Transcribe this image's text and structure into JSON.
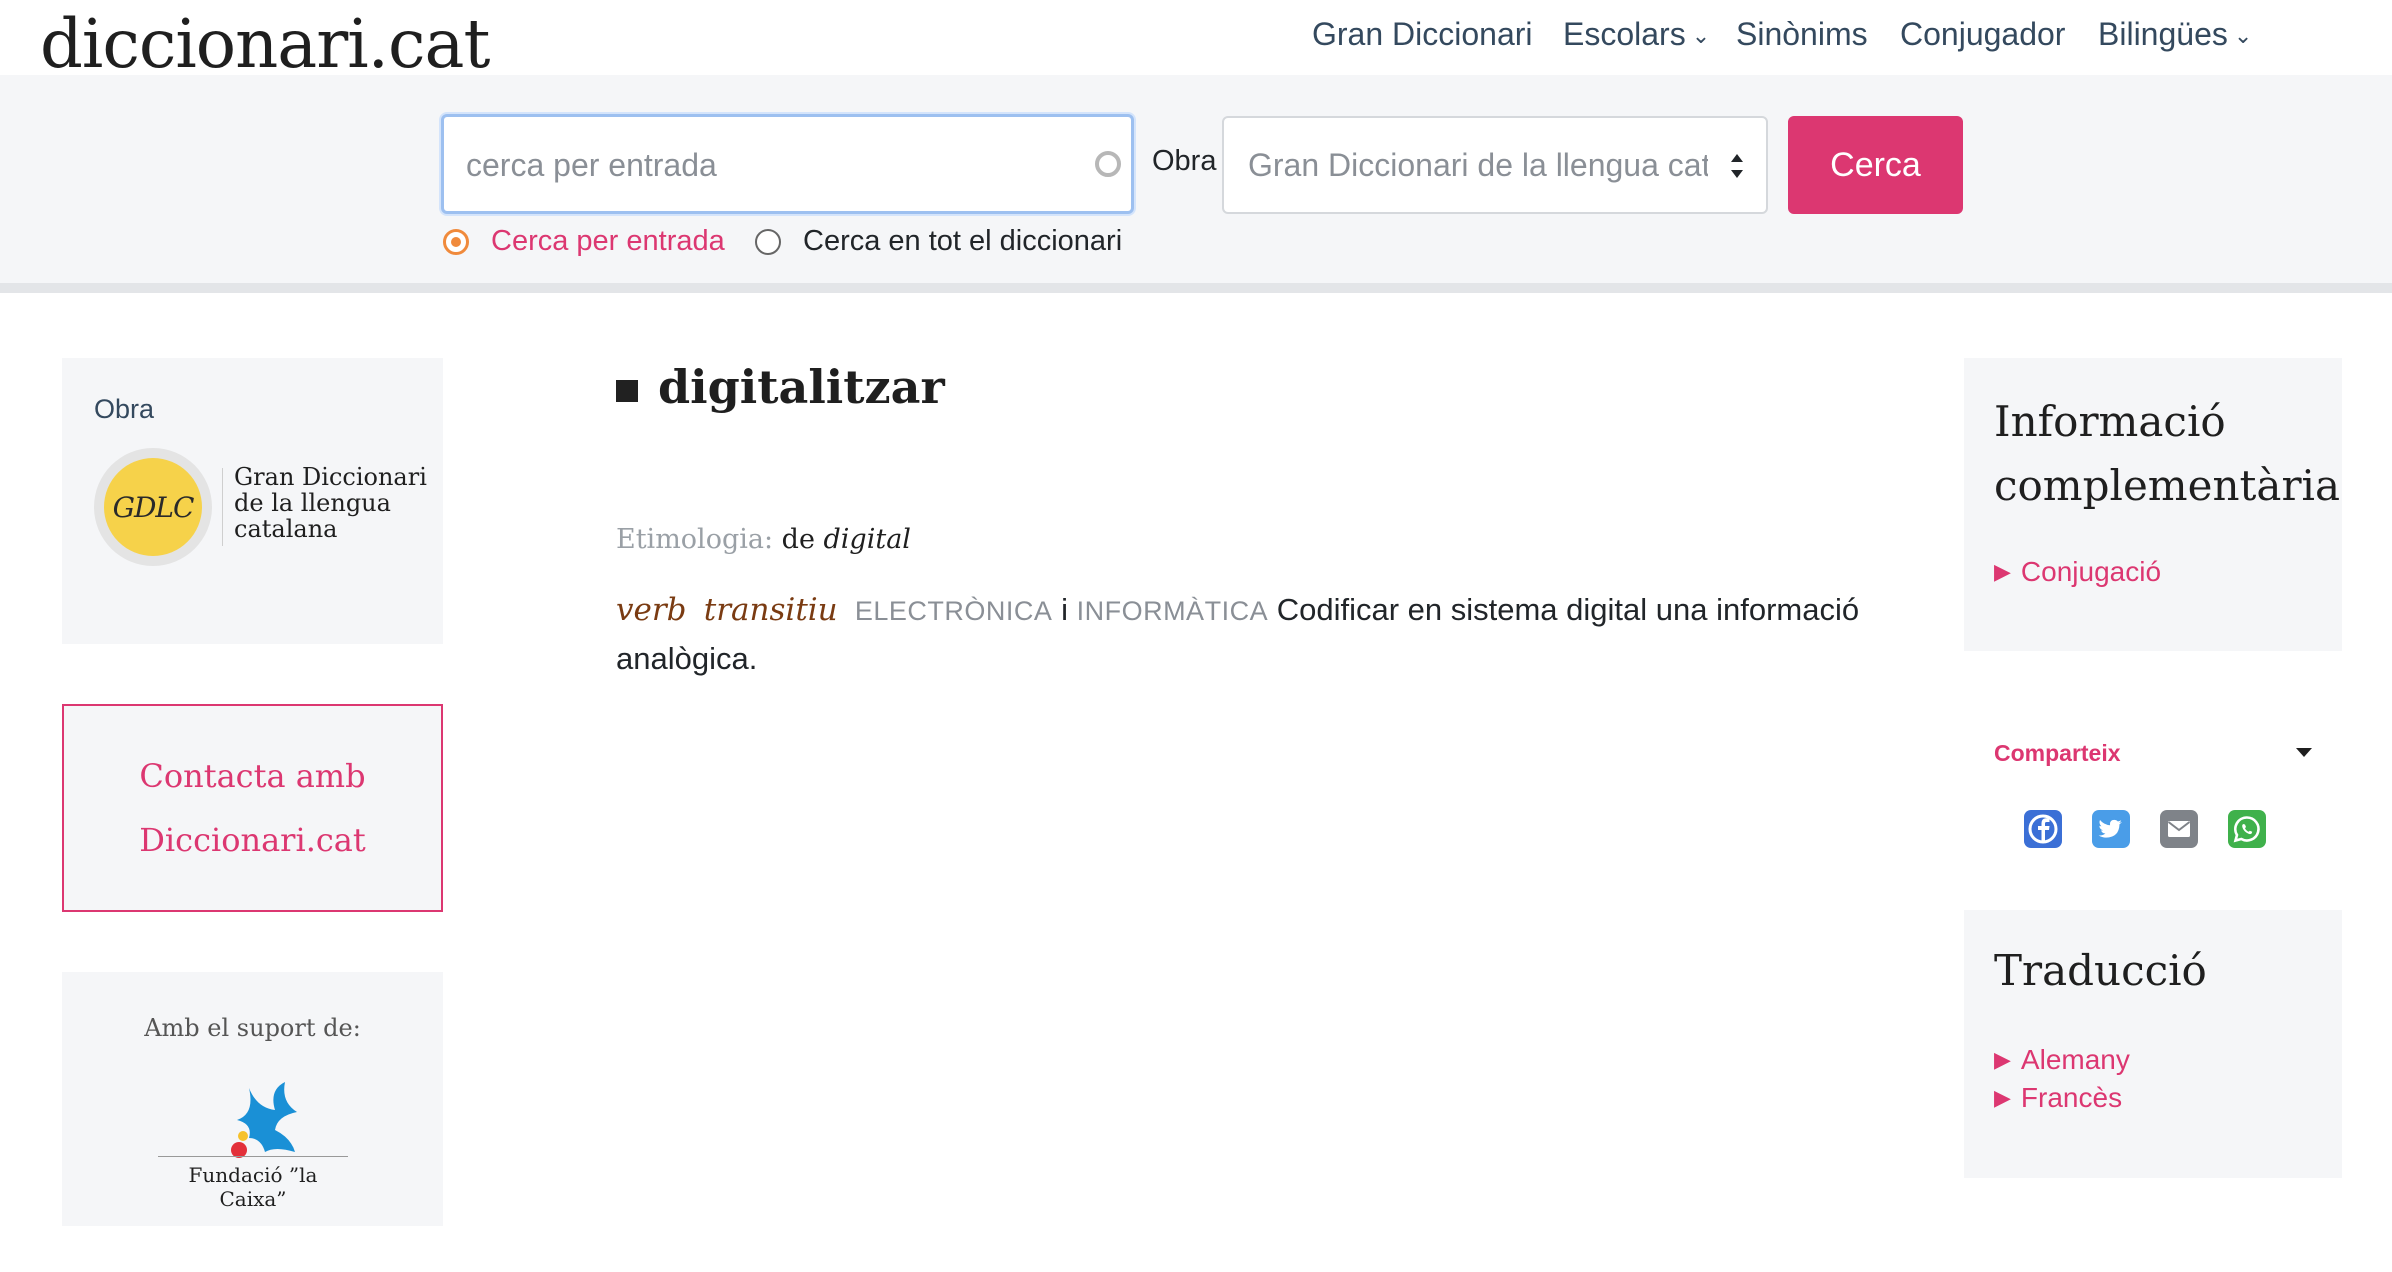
{
  "header": {
    "logo": "diccionari.cat",
    "nav": [
      {
        "label": "Gran Diccionari",
        "has_dropdown": false
      },
      {
        "label": "Escolars",
        "has_dropdown": true
      },
      {
        "label": "Sinònims",
        "has_dropdown": false
      },
      {
        "label": "Conjugador",
        "has_dropdown": false
      },
      {
        "label": "Bilingües",
        "has_dropdown": true
      }
    ]
  },
  "search": {
    "placeholder": "cerca per entrada",
    "value": "",
    "obra_label": "Obra",
    "obra_selected": "Gran Diccionari de la llengua catalana",
    "button_label": "Cerca",
    "radio_entry": "Cerca per entrada",
    "radio_all": "Cerca en tot el diccionari",
    "radio_selected": "entry"
  },
  "left_sidebar": {
    "obra_label": "Obra",
    "work_logo_text": "GDLC",
    "work_name": "Gran Diccionari de la llengua catalana",
    "contact_line1": "Contacta amb",
    "contact_line2": "Diccionari.cat",
    "support_label": "Amb el suport de:",
    "sponsor_name": "Fundació ”la Caixa”"
  },
  "entry": {
    "headword": "digitalitzar",
    "etymology_label": "Etimologia:",
    "etymology_prefix": "de",
    "etymology_word": "digital",
    "gram_1": "verb",
    "gram_2": "transitiu",
    "domain_1": "ELECTRÒNICA",
    "domain_join": "i",
    "domain_2": "INFORMÀTICA",
    "definition": "Codificar en sistema digital una informació analògica."
  },
  "right_sidebar": {
    "info_title": "Informació complementària",
    "info_link": "Conjugació",
    "share_label": "Comparteix",
    "share_icons": [
      "facebook-icon",
      "twitter-icon",
      "email-icon",
      "whatsapp-icon"
    ],
    "translation_title": "Traducció",
    "translation_links": [
      "Alemany",
      "Francès"
    ]
  },
  "colors": {
    "accent": "#dc3771",
    "radio_checked": "#f08a3c",
    "panel_bg": "#f5f6f8",
    "focus_border": "#9dc0f0",
    "grammar": "#7a3b12"
  }
}
